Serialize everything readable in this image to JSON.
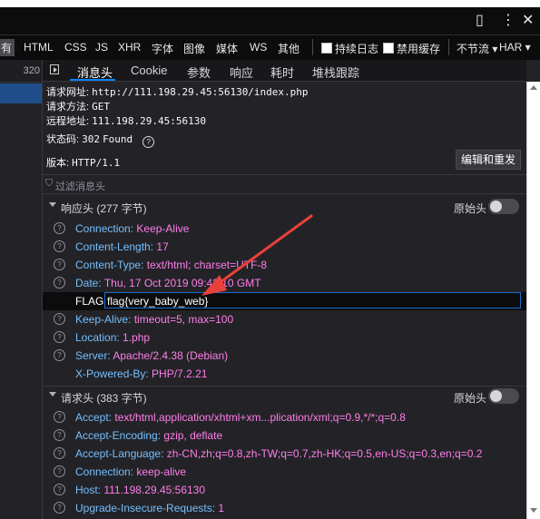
{
  "toolbar": {
    "cut_label": "有",
    "filters": [
      "HTML",
      "CSS",
      "JS",
      "XHR",
      "字体",
      "图像",
      "媒体",
      "WS",
      "其他"
    ],
    "persist_logs": "持续日志",
    "disable_cache": "禁用缓存",
    "throttle": "不节流 ▾",
    "har": "HAR ▾"
  },
  "list": {
    "column_cut": "320"
  },
  "tabs": [
    "消息头",
    "Cookie",
    "参数",
    "响应",
    "耗时",
    "堆栈跟踪"
  ],
  "summary": {
    "url_label": "请求网址:",
    "url_value": "http://111.198.29.45:56130/index.php",
    "method_label": "请求方法:",
    "method_value": "GET",
    "remote_label": "远程地址:",
    "remote_value": "111.198.29.45:56130",
    "status_label": "状态码:",
    "status_code": "302",
    "status_text": "Found",
    "version_label": "版本:",
    "version_value": "HTTP/1.1",
    "resend_button": "编辑和重发"
  },
  "filter_headers_placeholder": "过滤消息头",
  "response_headers": {
    "title": "响应头 (277 字节)",
    "raw_label": "原始头",
    "rows": [
      {
        "name": "Connection:",
        "value": "Keep-Alive"
      },
      {
        "name": "Content-Length:",
        "value": "17"
      },
      {
        "name": "Content-Type:",
        "value": "text/html; charset=UTF-8"
      },
      {
        "name": "Date:",
        "value": "Thu, 17 Oct 2019 09:43:10 GMT"
      }
    ],
    "flag_name": "FLAG:",
    "flag_value": "flag{very_baby_web}",
    "rows_after": [
      {
        "name": "Keep-Alive:",
        "value": "timeout=5, max=100"
      },
      {
        "name": "Location:",
        "value": "1.php"
      },
      {
        "name": "Server:",
        "value": "Apache/2.4.38 (Debian)"
      }
    ],
    "powered_name": "X-Powered-By:",
    "powered_value": "PHP/7.2.21"
  },
  "request_headers": {
    "title": "请求头 (383 字节)",
    "raw_label": "原始头",
    "rows": [
      {
        "name": "Accept:",
        "value": "text/html,application/xhtml+xm...plication/xml;q=0.9,*/*;q=0.8"
      },
      {
        "name": "Accept-Encoding:",
        "value": "gzip, deflate"
      },
      {
        "name": "Accept-Language:",
        "value": "zh-CN,zh;q=0.8,zh-TW;q=0.7,zh-HK;q=0.5,en-US;q=0.3,en;q=0.2"
      },
      {
        "name": "Connection:",
        "value": "keep-alive"
      },
      {
        "name": "Host:",
        "value": "111.198.29.45:56130"
      },
      {
        "name": "Upgrade-Insecure-Requests:",
        "value": "1"
      }
    ]
  },
  "colors": {
    "annotation_arrow": "#e8413b",
    "header_name": "#75bfff",
    "header_value": "#ff7de9",
    "selection": "#204e8a"
  }
}
